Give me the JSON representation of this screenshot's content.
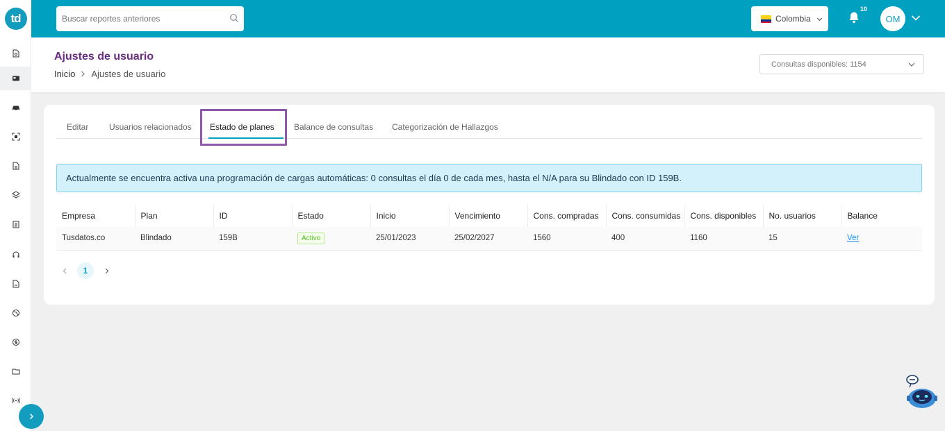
{
  "brand": {
    "logo_text": "td",
    "accent": "#00a0c1",
    "title_color": "#6a2c82",
    "highlight_color": "#8e58ab"
  },
  "sidebar": {
    "items": [
      {
        "icon": "document-search-icon"
      },
      {
        "icon": "id-card-icon",
        "active": true
      },
      {
        "icon": "car-icon"
      },
      {
        "icon": "scan-icon"
      },
      {
        "icon": "document-icon"
      },
      {
        "icon": "layers-icon"
      },
      {
        "icon": "clipboard-icon"
      },
      {
        "icon": "headset-icon"
      },
      {
        "icon": "file-icon"
      },
      {
        "icon": "globe-icon"
      },
      {
        "icon": "dollar-icon"
      },
      {
        "icon": "folder-icon"
      },
      {
        "icon": "broadcast-icon"
      }
    ]
  },
  "topbar": {
    "search_placeholder": "Buscar reportes anteriores",
    "country": "Colombia",
    "notifications": "10",
    "user_initials": "OM"
  },
  "header": {
    "title": "Ajustes de usuario",
    "breadcrumb": {
      "home": "Inicio",
      "current": "Ajustes de usuario"
    },
    "consultas": "Consultas disponibles: 1154"
  },
  "tabs": [
    {
      "label": "Editar"
    },
    {
      "label": "Usuarios relacionados"
    },
    {
      "label": "Estado de planes",
      "active": true
    },
    {
      "label": "Balance de consultas"
    },
    {
      "label": "Categorización de Hallazgos"
    }
  ],
  "alert": "Actualmente se encuentra activa una programación de cargas automáticas: 0 consultas el día 0 de cada mes, hasta el N/A para su Blindado con ID 159B.",
  "table": {
    "columns": [
      "Empresa",
      "Plan",
      "ID",
      "Estado",
      "Inicio",
      "Vencimiento",
      "Cons. compradas",
      "Cons. consumidas",
      "Cons. disponibles",
      "No. usuarios",
      "Balance"
    ],
    "rows": [
      {
        "empresa": "Tusdatos.co",
        "plan": "Blindado",
        "id": "159B",
        "estado": "Activo",
        "inicio": "25/01/2023",
        "vencimiento": "25/02/2027",
        "compradas": "1560",
        "consumidas": "400",
        "disponibles": "1160",
        "usuarios": "15",
        "balance": "Ver"
      }
    ]
  },
  "pagination": {
    "current": "1"
  }
}
